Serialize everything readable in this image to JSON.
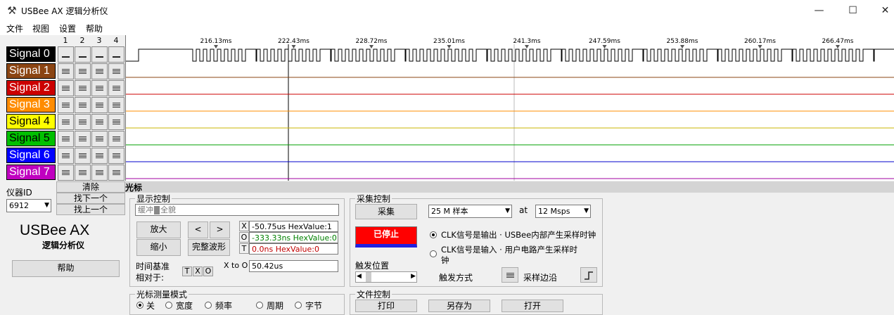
{
  "window": {
    "title": "USBee AX 逻辑分析仪",
    "minimize": "—",
    "maximize": "☐",
    "close": "✕"
  },
  "menu": [
    "文件",
    "视图",
    "设置",
    "帮助"
  ],
  "columns": [
    "1",
    "2",
    "3",
    "4"
  ],
  "signals": [
    {
      "label": "Signal 0",
      "bg": "#000000",
      "fg": "#ffffff",
      "trace": "#000000"
    },
    {
      "label": "Signal 1",
      "bg": "#8b4513",
      "fg": "#ffffff",
      "trace": "#8b4513"
    },
    {
      "label": "Signal 2",
      "bg": "#cc0000",
      "fg": "#ffffff",
      "trace": "#cc0000"
    },
    {
      "label": "Signal 3",
      "bg": "#ff8c00",
      "fg": "#ffffff",
      "trace": "#ff8c00"
    },
    {
      "label": "Signal 4",
      "bg": "#ffff00",
      "fg": "#000000",
      "trace": "#c8b400"
    },
    {
      "label": "Signal 5",
      "bg": "#00c000",
      "fg": "#000000",
      "trace": "#00a000"
    },
    {
      "label": "Signal 6",
      "bg": "#0000ff",
      "fg": "#ffffff",
      "trace": "#0000cc"
    },
    {
      "label": "Signal 7",
      "bg": "#c000c0",
      "fg": "#ffffff",
      "trace": "#a000a0"
    }
  ],
  "timeline": [
    "216.13ms",
    "222.43ms",
    "228.72ms",
    "235.01ms",
    "241.3ms",
    "247.59ms",
    "253.88ms",
    "260.17ms",
    "266.47ms"
  ],
  "side": {
    "clear": "清除",
    "find_next": "找下一个",
    "find_prev": "找上一个",
    "device_id_label": "仪器ID",
    "device_id": "6912",
    "logo_main": "USBee AX",
    "logo_sub": "逻辑分析仪",
    "help": "帮助"
  },
  "cursor_bar": "光标",
  "display": {
    "title": "显示控制",
    "buffer_label": "缓冲",
    "full_label": "全貌",
    "zoom_in": "放大",
    "zoom_out": "缩小",
    "left": "<",
    "right": ">",
    "full_wave": "完整波形",
    "x_label": "X",
    "x_value": "-50.75us HexValue:1",
    "o_label": "O",
    "o_value": "-333.33ns HexValue:0",
    "t_label": "T",
    "t_value": "0.0ns HexValue:0",
    "timebase_line1": "时间基准",
    "timebase_line2": "相对于:",
    "btn_t": "T",
    "btn_x": "X",
    "btn_o": "O",
    "x_to_o_label": "X to O",
    "x_to_o_value": "50.42us"
  },
  "measure": {
    "title": "光标测量模式",
    "options": [
      "关",
      "宽度",
      "频率",
      "周期",
      "字节"
    ]
  },
  "acquire": {
    "title": "采集控制",
    "capture": "采集",
    "samples": "25 M 样本",
    "at_label": "at",
    "rate": "12 Msps",
    "status": "已停止",
    "status_color": "#ff0000",
    "clk_out": "CLK信号是输出 · USBee内部产生采样时钟",
    "clk_in": "CLK信号是输入 · 用户电路产生采样时钟",
    "trigger_pos": "触发位置",
    "trigger_mode": "触发方式",
    "sample_edge": "采样边沿"
  },
  "file": {
    "title": "文件控制",
    "print": "打印",
    "save_as": "另存为",
    "open": "打开"
  }
}
